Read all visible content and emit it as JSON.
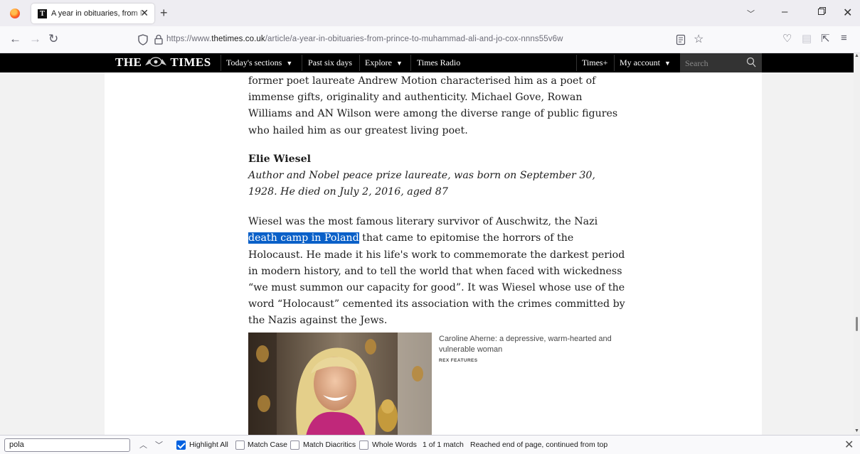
{
  "browser": {
    "tab_title": "A year in obituaries, from Prince to Muhammad Ali and Jo Cox",
    "tab_favicon": "T",
    "url_prefix": "https://www.",
    "url_domain": "thetimes.co.uk",
    "url_path": "/article/a-year-in-obituaries-from-prince-to-muhammad-ali-and-jo-cox-nnns55v6w"
  },
  "site_header": {
    "logo_left": "THE",
    "logo_right": "TIMES",
    "nav": [
      {
        "label": "Today's sections",
        "has_caret": true
      },
      {
        "label": "Past six days",
        "has_caret": false
      },
      {
        "label": "Explore",
        "has_caret": true
      },
      {
        "label": "Times Radio",
        "has_caret": false
      }
    ],
    "times_plus": "Times+",
    "account": "My account",
    "search_placeholder": "Search"
  },
  "article": {
    "para1": "former poet laureate Andrew Motion characterised him as a poet of immense gifts, originality and authenticity. Michael Gove, Rowan Williams and AN Wilson were among the diverse range of public figures who hailed him as our greatest living poet.",
    "heading": "Elie Wiesel",
    "standfirst": "Author and Nobel peace prize laureate, was born on September 30, 1928. He died on July 2, 2016, aged 87",
    "para2_before": "Wiesel was the most famous literary survivor of Auschwitz, the Nazi ",
    "para2_highlight": "death camp in Poland",
    "para2_after": " that came to epitomise the horrors of the Holocaust. He made it his life's work to commemorate the darkest period in modern history, and to tell the world that when faced with wickedness “we must summon our capacity for good”. It was Wiesel whose use of the word “Holocaust” cemented its association with the crimes committed by the Nazis against the Jews.",
    "image_caption": "Caroline Aherne: a depressive, warm-hearted and vulnerable woman",
    "image_credit": "REX FEATURES"
  },
  "find_bar": {
    "query": "pola",
    "highlight_all": "Highlight All",
    "match_case": "Match Case",
    "match_diacritics": "Match Diacritics",
    "whole_words": "Whole Words",
    "match_count": "1 of 1 match",
    "status": "Reached end of page, continued from top",
    "highlight_all_checked": true,
    "match_case_checked": false,
    "match_diacritics_checked": false,
    "whole_words_checked": false
  },
  "colors": {
    "highlight": "#0a60c8",
    "times_bar": "#000000",
    "checkbox_on": "#0061e0"
  }
}
